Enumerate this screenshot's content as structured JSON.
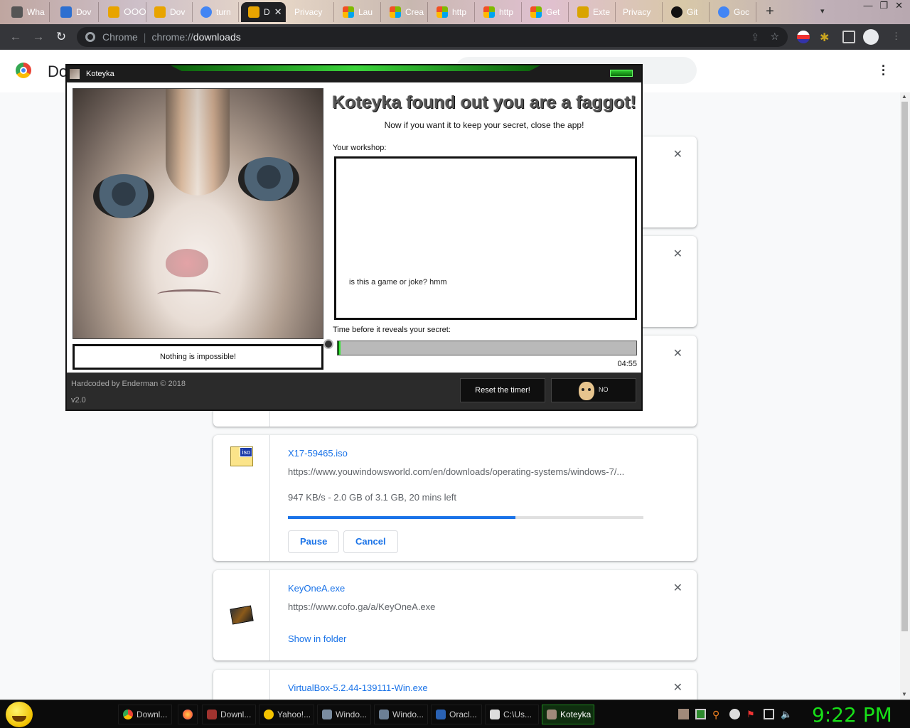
{
  "browser": {
    "tabs": [
      {
        "label": "Wha",
        "color": "#555555"
      },
      {
        "label": "Dov",
        "color": "#2d6fd0"
      },
      {
        "label": "ⵔⵔⵔ",
        "color": "#e8a400"
      },
      {
        "label": "Dov",
        "color": "#e8a400"
      },
      {
        "label": "turn",
        "color": "#4285f4"
      },
      {
        "label": "D",
        "color": "#e8a400",
        "active": true
      },
      {
        "label": "Privacy",
        "color": "#bbbbbb"
      },
      {
        "label": "Lau",
        "color": "#f25022"
      },
      {
        "label": "Crea",
        "color": "#f25022"
      },
      {
        "label": "http",
        "color": "#f25022"
      },
      {
        "label": "http",
        "color": "#f25022"
      },
      {
        "label": "Get",
        "color": "#f25022"
      },
      {
        "label": "Exte",
        "color": "#d9a400"
      },
      {
        "label": "Privacy",
        "color": "#bbbbbb"
      },
      {
        "label": "Git",
        "color": "#111111"
      },
      {
        "label": "Goc",
        "color": "#4285f4"
      }
    ],
    "omnibox": {
      "site_label": "Chrome",
      "scheme": "chrome://",
      "host": "downloads"
    }
  },
  "page": {
    "title": "Do"
  },
  "downloads": {
    "iso": {
      "name": "X17-59465.iso",
      "url": "https://www.youwindowsworld.com/en/downloads/operating-systems/windows-7/...",
      "status": "947 KB/s - 2.0 GB of 3.1 GB, 20 mins left",
      "progress": 0.64,
      "pause_label": "Pause",
      "cancel_label": "Cancel",
      "icon_text": "iso"
    },
    "keyone": {
      "name": "KeyOneA.exe",
      "url": "https://www.cofo.ga/a/KeyOneA.exe",
      "link": "Show in folder"
    },
    "vbox": {
      "name": "VirtualBox-5.2.44-139111-Win.exe"
    }
  },
  "koteyka": {
    "window_title": "Koteyka",
    "headline": "Koteyka found out you are a faggot!",
    "subline": "Now if you want it to keep your secret, close the app!",
    "workshop_label": "Your workshop:",
    "workshop_text": "is this a game or joke? hmm",
    "motto": "Nothing is impossible!",
    "timer_label": "Time before it reveals your secret:",
    "timer_value": "04:55",
    "timer_progress": 0.01,
    "credit": "Hardcoded by Enderman © 2018",
    "version": "v2.0",
    "reset_label": "Reset the timer!",
    "baldi_label": "NO"
  },
  "taskbar": {
    "items": [
      {
        "label": "Downl...",
        "color": "#4285f4"
      },
      {
        "label": "",
        "color": "#ff7139"
      },
      {
        "label": "Downl...",
        "color": "#a0332f"
      },
      {
        "label": "Yahoo!...",
        "color": "#f5c400"
      },
      {
        "label": "Windo...",
        "color": "#7a8ca0"
      },
      {
        "label": "Windo...",
        "color": "#6c7f95"
      },
      {
        "label": "Oracl...",
        "color": "#2a62b4"
      },
      {
        "label": "C:\\Us...",
        "color": "#dddddd"
      },
      {
        "label": "Koteyka",
        "color": "#a08a7a",
        "active": true
      }
    ],
    "clock": "9:22 PM"
  }
}
